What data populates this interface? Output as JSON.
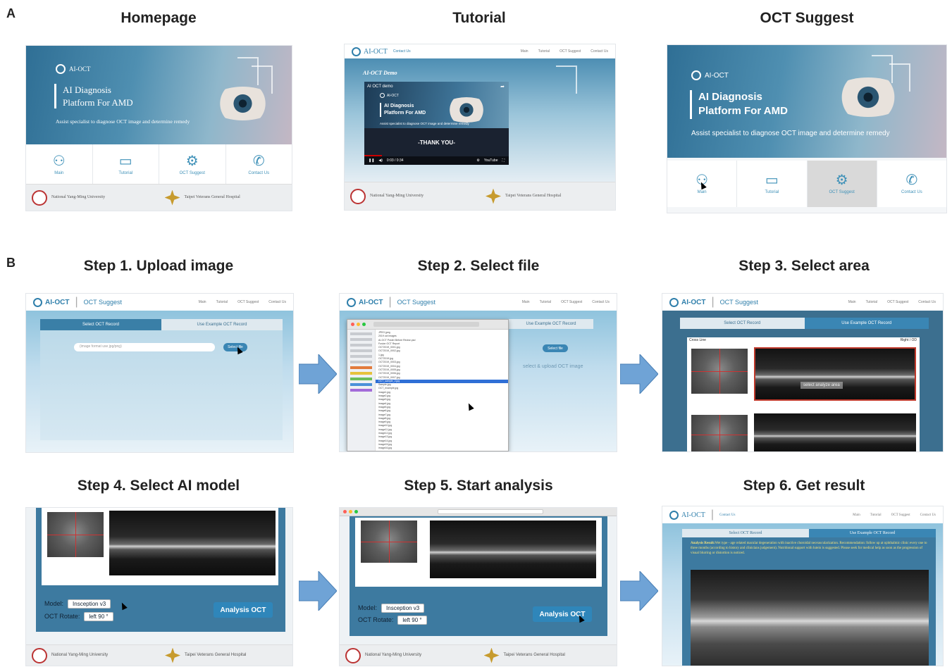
{
  "panel_a": {
    "letter": "A",
    "captions": [
      "Homepage",
      "Tutorial",
      "OCT Suggest"
    ],
    "hero": {
      "logo": "AI-OCT",
      "title_line1": "AI Diagnosis",
      "title_line2": "Platform For AMD",
      "subtitle": "Assist specialist to diagnose OCT image and determine remedy"
    },
    "nav": [
      "Main",
      "Tutorial",
      "OCT Suggest",
      "Contact Us"
    ],
    "footer": {
      "univ": "National Yang-Ming University",
      "hosp": "Taipei Veterans General Hospital"
    },
    "tutorial": {
      "topbar_brand": "AI-OCT",
      "topbar_section": "Contact Us",
      "menus": [
        "Main",
        "Tutorial",
        "OCT Suggest",
        "Contact Us"
      ],
      "demo_heading": "AI-OCT Demo",
      "video_title": "AI OCT demo",
      "video_logo": "AI-OCT",
      "video_line1": "AI Diagnosis",
      "video_line2": "Platform For AMD",
      "video_sub": "Assist specialist to diagnose OCT image and determine remedy",
      "thank_you": "-THANK YOU-",
      "time": "0:03 / 0:34",
      "youtube": "YouTube"
    }
  },
  "panel_b": {
    "letter": "B",
    "captions": [
      "Step 1. Upload image",
      "Step 2. Select file",
      "Step 3. Select area",
      "Step 4. Select AI model",
      "Step 5. Start analysis",
      "Step 6. Get result"
    ],
    "brand": "AI-OCT",
    "section": "OCT Suggest",
    "section_contact": "Contact Us",
    "menus": [
      "Main",
      "Tutorial",
      "OCT Suggest",
      "Contact Us"
    ],
    "tab_select": "Select OCT Record",
    "tab_example": "Use Example OCT Record",
    "placeholder": "(image format use jpg/png)",
    "select_file": "Select file",
    "select_upload": "select & upload OCT image",
    "cross_line": "Cross Line",
    "right_od": "Right / OD",
    "select_analyze": "select analyze area",
    "model_label": "Model:",
    "model_value": "Insception v3",
    "rotate_label": "OCT Rotate:",
    "rotate_value": "left 90 °",
    "analysis_button": "Analysis OCT",
    "result_label": "Analysis Result:",
    "result_text": "Wet type - age related macular degeneration with inactive choroidal neovascularization. Recommendation: follow up at ophthalmic clinic every one to three months (according to history and clinicians judgement). Nutritional support with lutein is suggested. Please seek for medical help as soon as the progression of visual blurring or distortion is noticed.",
    "files": [
      "JPEG.jpeg",
      "2019 oct images",
      "AI-OCT Poster Before Revise.psd",
      "Fusion OCT Report",
      "OCT2019_0001.jpg",
      "OCT2019_0002.jpg",
      "1.jpg",
      "OCT2019.jpg",
      "OCT2019_0003.jpg",
      "OCT2019_0004.jpg",
      "OCT2019_0005.jpg",
      "OCT2019_0006.jpg",
      "OCT2019_0007.jpg",
      "OCT_sample_2.jpg",
      "Sample.jpg",
      "OCT_example.jpg",
      "image1.jpg",
      "image2.jpg",
      "image3.jpg",
      "image4.jpg",
      "image5.jpg",
      "image6.jpg",
      "image7.jpg",
      "image8.jpg",
      "image9.jpg",
      "image10.jpg",
      "image11.jpg",
      "image12.jpg",
      "image13.jpg",
      "image14.jpg",
      "image15.jpg",
      "image16.jpg",
      "image17.jpg",
      "image18.jpg",
      "image19.jpg"
    ],
    "selected_file_index": 13
  },
  "colors": {
    "accent": "#3f91b8",
    "brand": "#2f7fab",
    "button": "#2f86ba",
    "result_text": "#f4e27a"
  }
}
